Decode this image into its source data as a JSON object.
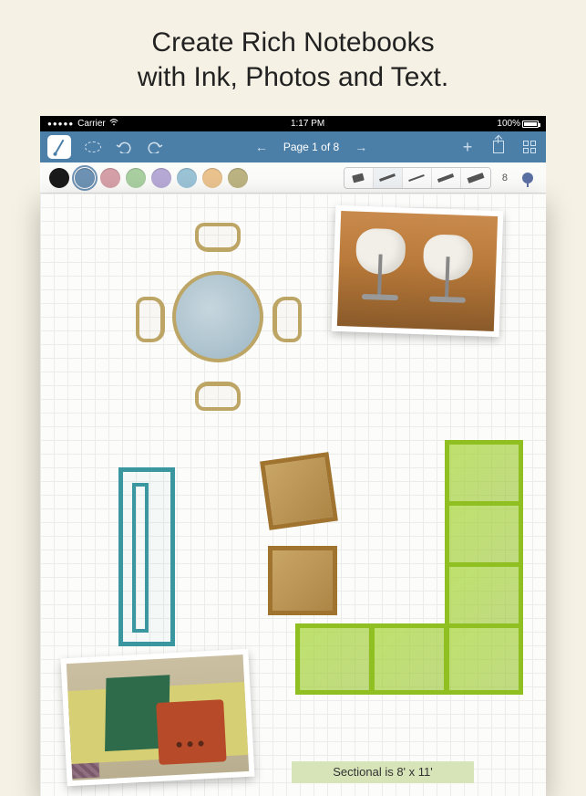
{
  "marketing": {
    "headline_line1": "Create Rich Notebooks",
    "headline_line2": "with Ink, Photos and Text."
  },
  "statusbar": {
    "carrier": "Carrier",
    "time": "1:17 PM",
    "battery": "100%"
  },
  "toolbar": {
    "page_label": "Page 1 of 8"
  },
  "color_palette": {
    "swatches": [
      {
        "hex": "#1a1a1a",
        "selected": false
      },
      {
        "hex": "#6d92b3",
        "selected": true
      },
      {
        "hex": "#d6a0a8",
        "selected": false
      },
      {
        "hex": "#a9cfa1",
        "selected": false
      },
      {
        "hex": "#b7a9d6",
        "selected": false
      },
      {
        "hex": "#9bc3d6",
        "selected": false
      },
      {
        "hex": "#e9c28e",
        "selected": false
      },
      {
        "hex": "#bcb382",
        "selected": false
      }
    ],
    "brush_widths": [
      2,
      3,
      2,
      4,
      6
    ],
    "brush_selected": 1,
    "size_value": "8"
  },
  "canvas": {
    "text_note": "Sectional is 8' x 11'"
  }
}
